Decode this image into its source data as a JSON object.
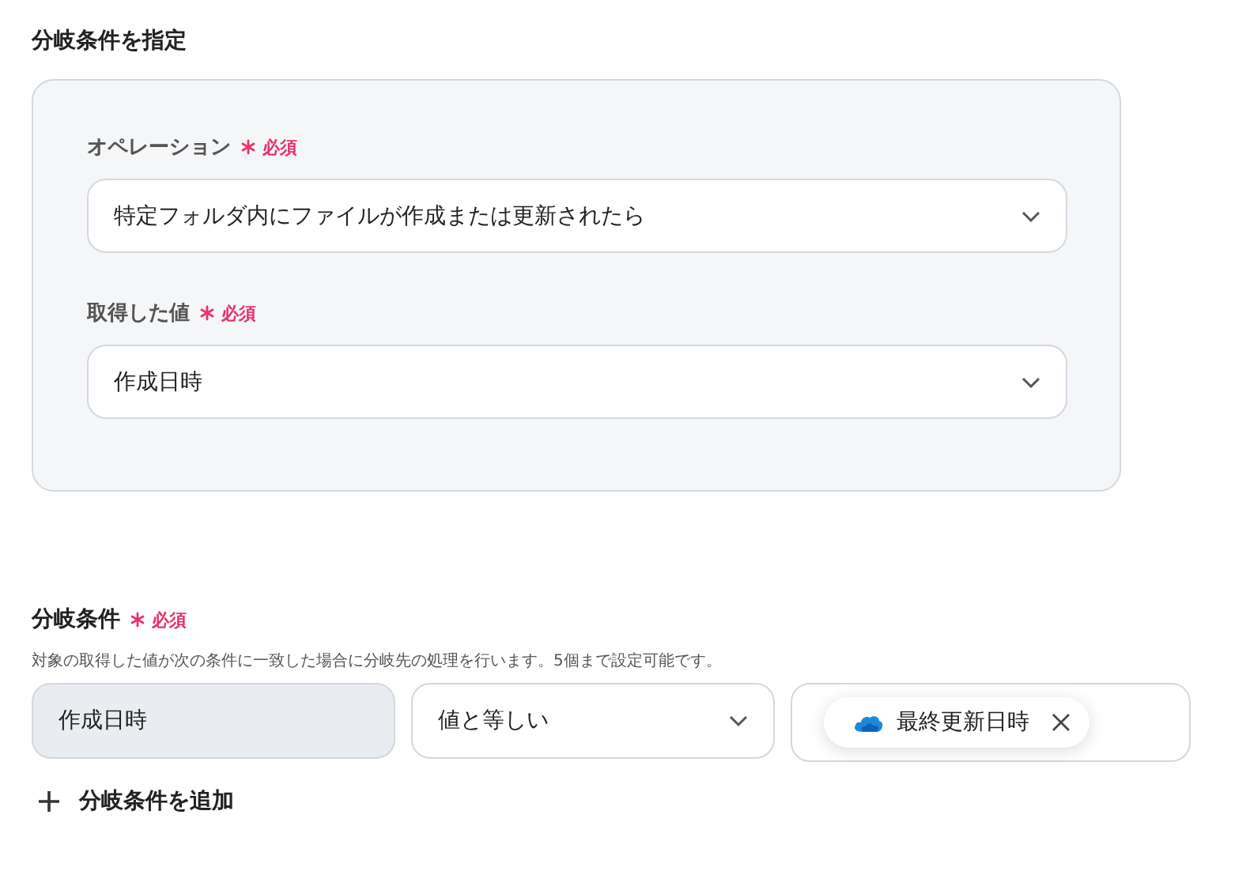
{
  "title": "分岐条件を指定",
  "card": {
    "fields": [
      {
        "label": "オペレーション",
        "required": true,
        "required_text": "必須",
        "value": "特定フォルダ内にファイルが作成または更新されたら"
      },
      {
        "label": "取得した値",
        "required": true,
        "required_text": "必須",
        "value": "作成日時"
      }
    ]
  },
  "condition": {
    "label": "分岐条件",
    "required": true,
    "required_text": "必須",
    "description": "対象の取得した値が次の条件に一致した場合に分岐先の処理を行います。5個まで設定可能です。",
    "field_value": "作成日時",
    "operator": "値と等しい",
    "chip": {
      "text": "最終更新日時"
    }
  },
  "add_button": {
    "label": "分岐条件を追加"
  }
}
